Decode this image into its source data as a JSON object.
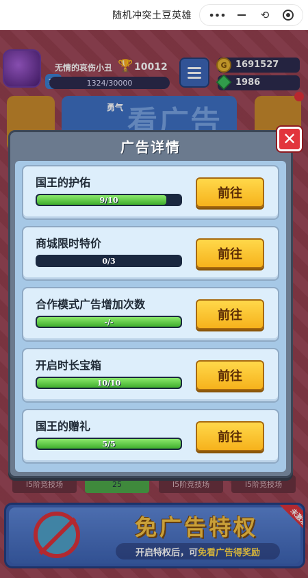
{
  "app": {
    "title": "随机冲突土豆英雄",
    "capsule": {
      "more": "•••",
      "restore": "⟲"
    }
  },
  "hud": {
    "player_name": "无情的哀伤小丑",
    "level": "13",
    "trophies": "10012",
    "exp": "1324/30000",
    "coins": "1691527",
    "gems": "1986",
    "coin_symbol": "G"
  },
  "background": {
    "banner": "看广告",
    "courage_label": "勇气",
    "arena_label": "I5阶竞技场",
    "green_count": "25"
  },
  "modal": {
    "title": "广告详情",
    "close_symbol": "✕",
    "tasks": [
      {
        "name": "国王的护佑",
        "progress": "9/10",
        "fill": 0.9,
        "button": "前往"
      },
      {
        "name": "商城限时特价",
        "progress": "0/3",
        "fill": 0,
        "button": "前往"
      },
      {
        "name": "合作模式广告增加次数",
        "progress": "-/-",
        "fill": 1,
        "button": "前往"
      },
      {
        "name": "开启时长宝箱",
        "progress": "10/10",
        "fill": 1,
        "button": "前往"
      },
      {
        "name": "国王的赠礼",
        "progress": "5/5",
        "fill": 1,
        "button": "前往"
      }
    ]
  },
  "ad_free": {
    "title": "免广告特权",
    "desc_prefix": "开启特权后，可",
    "desc_highlight": "免看广告得奖励",
    "corner": "未激活"
  },
  "colors": {
    "go_button": "#f6b21c",
    "progress_fill": "#3fae2d",
    "close_button": "#e2343c",
    "modal_body": "#a6c8e6"
  }
}
